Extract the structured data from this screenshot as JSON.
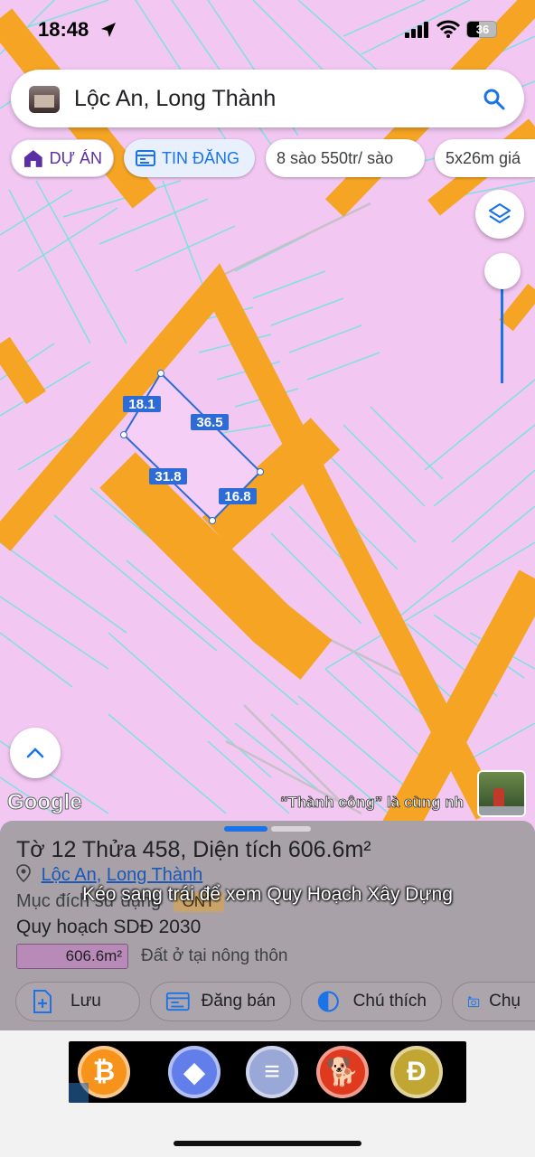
{
  "status": {
    "time": "18:48",
    "battery": "36"
  },
  "search": {
    "query": "Lộc An, Long Thành"
  },
  "chips": [
    {
      "label": "DỰ ÁN",
      "icon": "house-icon"
    },
    {
      "label": "TIN ĐĂNG",
      "icon": "listing-icon"
    },
    {
      "label": "8 sào 550tr/ sào"
    },
    {
      "label": "5x26m giá"
    }
  ],
  "parcel": {
    "edges": [
      {
        "label": "18.1"
      },
      {
        "label": "36.5"
      },
      {
        "label": "31.8"
      },
      {
        "label": "16.8"
      }
    ]
  },
  "map": {
    "google_logo": "Google",
    "overlay_text": "“Thành công” là cùng nh",
    "colors": {
      "land": "#f2c8f2",
      "road": "#f5a523",
      "parcel_line": "#7fe0e0",
      "parcel_edge": "#2d6cd6"
    }
  },
  "sheet": {
    "title": "Tờ 12 Thửa 458, Diện tích 606.6m²",
    "location": {
      "commune": "Lộc An",
      "separator": ", ",
      "district": "Long Thành"
    },
    "purpose_label": "Mục đích sử dụng",
    "purpose_badge": "ONT",
    "plan_label": "Quy hoạch SDĐ 2030",
    "area_badge": "606.6m²",
    "area_desc": "Đất ở tại nông thôn",
    "actions": [
      {
        "label": "Lưu",
        "icon": "save-add-icon"
      },
      {
        "label": "Đăng bán",
        "icon": "post-listing-icon"
      },
      {
        "label": "Chú thích",
        "icon": "legend-icon"
      },
      {
        "label": "Chụ",
        "icon": "camera-icon"
      }
    ]
  },
  "caption": "Kéo sang trái để xem Quy Hoạch Xây Dựng",
  "ad": {
    "coins": [
      {
        "name": "bitcoin-coin",
        "symbol": "₿",
        "color": "#f7931a"
      },
      {
        "name": "ethereum-coin",
        "symbol": "◆",
        "color": "#627eea"
      },
      {
        "name": "solana-coin",
        "symbol": "≡",
        "color": "#9aa8d8"
      },
      {
        "name": "shiba-coin",
        "symbol": "🐕",
        "color": "#e03a1e"
      },
      {
        "name": "dogecoin-coin",
        "symbol": "Ð",
        "color": "#c2a633"
      }
    ]
  }
}
